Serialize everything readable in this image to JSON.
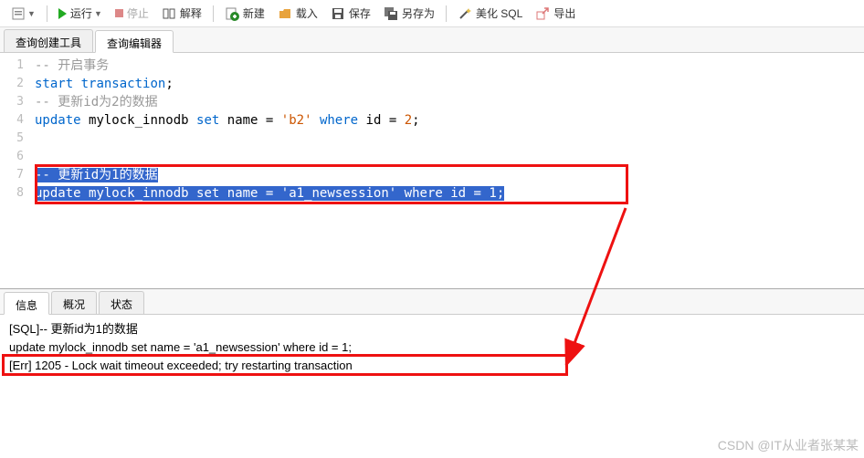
{
  "toolbar": {
    "run": "运行",
    "stop": "停止",
    "explain": "解释",
    "new": "新建",
    "load": "载入",
    "save": "保存",
    "saveas": "另存为",
    "beautify": "美化 SQL",
    "export": "导出"
  },
  "tabs": {
    "builder": "查询创建工具",
    "editor": "查询编辑器"
  },
  "code": {
    "l1_comment": "-- 开启事务",
    "l2_start": "start",
    "l2_trans": "transaction",
    "l2_semi": ";",
    "l3_comment": "-- 更新id为2的数据",
    "l4_update": "update",
    "l4_tbl": "mylock_innodb",
    "l4_set": "set",
    "l4_name": "name",
    "l4_eq": " = ",
    "l4_str": "'b2'",
    "l4_where": "where",
    "l4_id": "id",
    "l4_eq2": " = ",
    "l4_num": "2",
    "l4_semi": ";",
    "l7_comment": "-- 更新id为1的数据",
    "l8_update": "update",
    "l8_tbl": "mylock_innodb",
    "l8_set": "set",
    "l8_name": "name",
    "l8_eq": " = ",
    "l8_str": "'a1_newsession'",
    "l8_where": "where",
    "l8_id": "id",
    "l8_eq2": " = ",
    "l8_num": "1",
    "l8_semi": ";"
  },
  "bottomtabs": {
    "info": "信息",
    "profile": "概况",
    "status": "状态"
  },
  "output": {
    "line1": "[SQL]-- 更新id为1的数据",
    "line2": "update mylock_innodb set name = 'a1_newsession' where id = 1;",
    "line3": "[Err] 1205 - Lock wait timeout exceeded; try restarting transaction"
  },
  "watermark": "CSDN @IT从业者张某某"
}
